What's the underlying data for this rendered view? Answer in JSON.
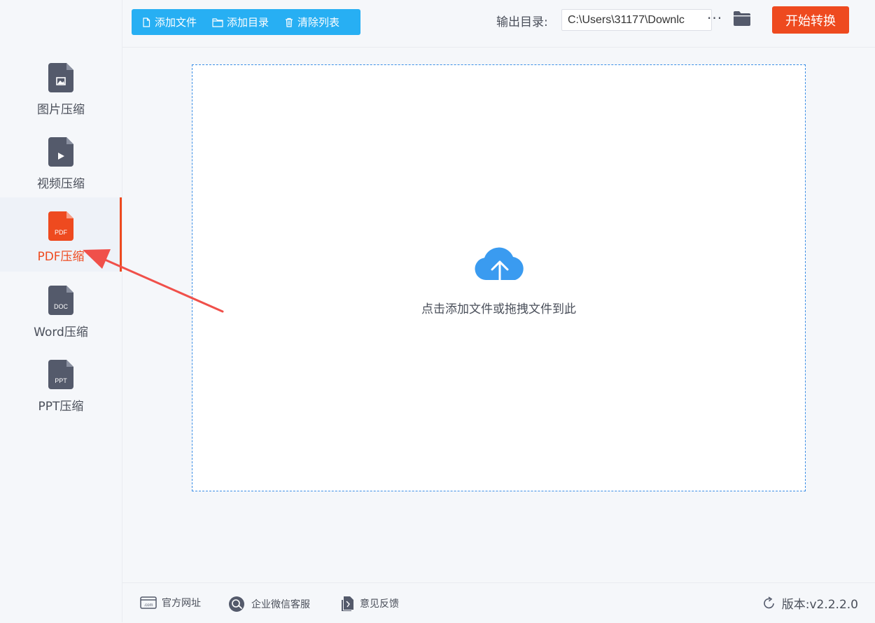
{
  "sidebar": {
    "items": [
      {
        "label": "图片压缩",
        "icon": "image-file-icon",
        "badge": ""
      },
      {
        "label": "视频压缩",
        "icon": "video-file-icon",
        "badge": ""
      },
      {
        "label": "PDF压缩",
        "icon": "pdf-file-icon",
        "badge": "PDF",
        "active": true
      },
      {
        "label": "Word压缩",
        "icon": "doc-file-icon",
        "badge": "DOC"
      },
      {
        "label": "PPT压缩",
        "icon": "ppt-file-icon",
        "badge": "PPT"
      }
    ]
  },
  "toolbar": {
    "add_file": "添加文件",
    "add_dir": "添加目录",
    "clear_list": "清除列表",
    "output_label": "输出目录:",
    "output_path": "C:\\Users\\31177\\Downlc",
    "more": "···",
    "start": "开始转换"
  },
  "dropzone": {
    "hint": "点击添加文件或拖拽文件到此"
  },
  "footer": {
    "website": "官方网址",
    "wechat": "企业微信客服",
    "feedback": "意见反馈",
    "version": "版本:v2.2.2.0"
  },
  "colors": {
    "accent": "#ee4a1f",
    "toolbar_blue": "#27aff3",
    "icon_gray": "#545a6b",
    "dropzone_border": "#3a8ee6",
    "cloud_blue": "#3a9bf0"
  }
}
